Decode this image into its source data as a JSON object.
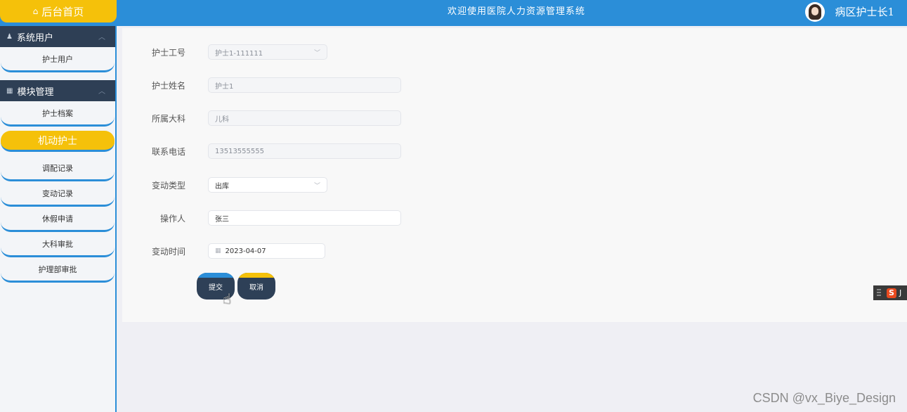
{
  "header": {
    "home_label": "后台首页",
    "system_title": "欢迎使用医院人力资源管理系统",
    "user_name": "病区护士长1"
  },
  "sidebar": {
    "groups": [
      {
        "label": "系统用户",
        "icon": "person-icon",
        "items": [
          {
            "label": "护士用户"
          }
        ]
      },
      {
        "label": "模块管理",
        "icon": "grid-icon",
        "items": [
          {
            "label": "护士档案"
          },
          {
            "label": "机动护士",
            "active": true
          },
          {
            "label": "调配记录"
          },
          {
            "label": "变动记录"
          },
          {
            "label": "休假申请"
          },
          {
            "label": "大科审批"
          },
          {
            "label": "护理部审批"
          }
        ]
      }
    ]
  },
  "form": {
    "nurse_id": {
      "label": "护士工号",
      "value": "护士1-111111"
    },
    "nurse_name": {
      "label": "护士姓名",
      "value": "护士1"
    },
    "department": {
      "label": "所属大科",
      "value": "儿科"
    },
    "phone": {
      "label": "联系电话",
      "value": "13513555555"
    },
    "change_type": {
      "label": "变动类型",
      "value": "出库"
    },
    "operator": {
      "label": "操作人",
      "value": "张三"
    },
    "change_time": {
      "label": "变动时间",
      "value": "2023-04-07"
    }
  },
  "actions": {
    "submit": "提交",
    "cancel": "取消"
  },
  "ime": {
    "brand": "S",
    "extra": "J"
  },
  "watermark": "CSDN @vx_Biye_Design"
}
